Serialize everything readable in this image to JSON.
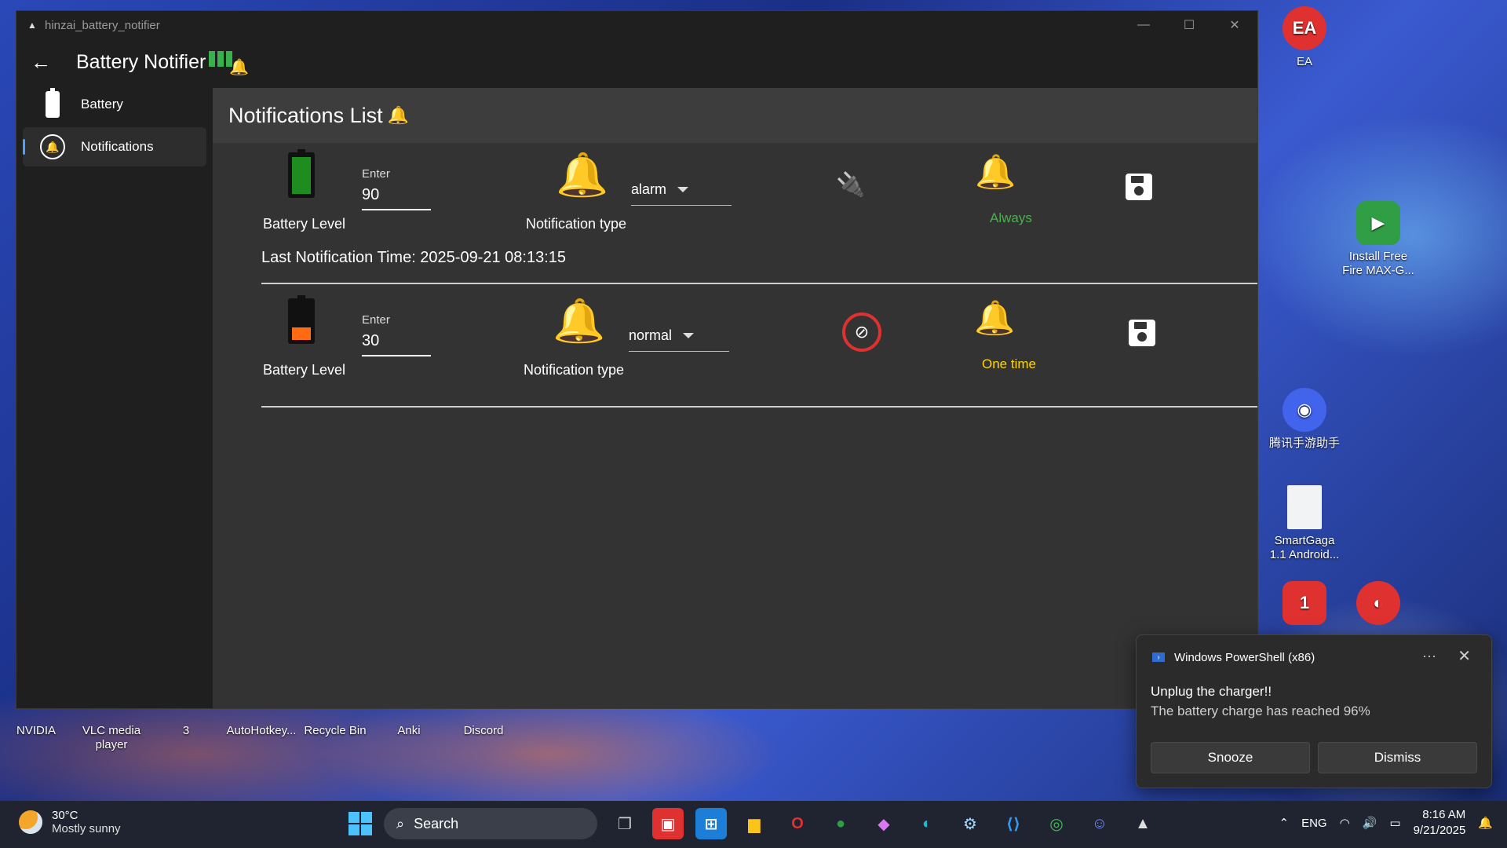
{
  "desktop": {
    "icons_right": [
      {
        "label": "EA",
        "color": "#e03131",
        "glyph": "EA"
      },
      {
        "label": "Install Free Fire MAX-G...",
        "color": "#2f9e44",
        "glyph": "▶"
      },
      {
        "label": "腾讯手游助手",
        "color": "#4263eb",
        "glyph": "◉"
      },
      {
        "label": "SmartGaga 1.1 Android...",
        "color": "#f1f3f5",
        "glyph": ""
      }
    ],
    "icons_bottom": [
      {
        "label": "NVIDIA",
        "color": "#2b8a3e",
        "glyph": "N"
      },
      {
        "label": "VLC media player",
        "color": "#f08c00",
        "glyph": "▲"
      },
      {
        "label": "3",
        "color": "#2f9e44",
        "glyph": "3"
      },
      {
        "label": "AutoHotkey...",
        "color": "#2f9e44",
        "glyph": "H"
      },
      {
        "label": "Recycle Bin",
        "color": "#adb5bd",
        "glyph": "♻"
      },
      {
        "label": "Anki",
        "color": "#74c0fc",
        "glyph": "★"
      },
      {
        "label": "Discord",
        "color": "#5c7cfa",
        "glyph": "D"
      }
    ]
  },
  "window": {
    "title": "hinzai_battery_notifier",
    "app_title": "Battery Notifier",
    "controls": {
      "minimize": "—",
      "maximize": "☐",
      "close": "✕"
    }
  },
  "sidebar": {
    "items": [
      {
        "label": "Battery",
        "active": false
      },
      {
        "label": "Notifications",
        "active": true
      }
    ]
  },
  "main": {
    "heading": "Notifications List",
    "rows": [
      {
        "battery_level_label": "Battery Level",
        "battery_fill_percent": 90,
        "battery_color": "#1e8c1e",
        "input_label": "Enter",
        "input_value": "90",
        "notification_type_label": "Notification type",
        "notification_type": "alarm",
        "charger_state": "plugged",
        "repeat_label": "Always",
        "repeat_color": "#4caf50",
        "last_notification": "Last Notification Time: 2025-09-21 08:13:15"
      },
      {
        "battery_level_label": "Battery Level",
        "battery_fill_percent": 30,
        "battery_color": "#ff6a13",
        "input_label": "Enter",
        "input_value": "30",
        "notification_type_label": "Notification type",
        "notification_type": "normal",
        "charger_state": "unplugged",
        "repeat_label": "One time",
        "repeat_color": "#ffd600"
      }
    ]
  },
  "toast": {
    "app": "Windows PowerShell (x86)",
    "title": "Unplug the charger!!",
    "body": "The battery charge has reached  96%",
    "more": "···",
    "close": "✕",
    "buttons": [
      "Snooze",
      "Dismiss"
    ]
  },
  "taskbar": {
    "weather_temp": "30°C",
    "weather_desc": "Mostly sunny",
    "search_placeholder": "Search",
    "language": "ENG",
    "time": "8:16 AM",
    "date": "9/21/2025"
  }
}
